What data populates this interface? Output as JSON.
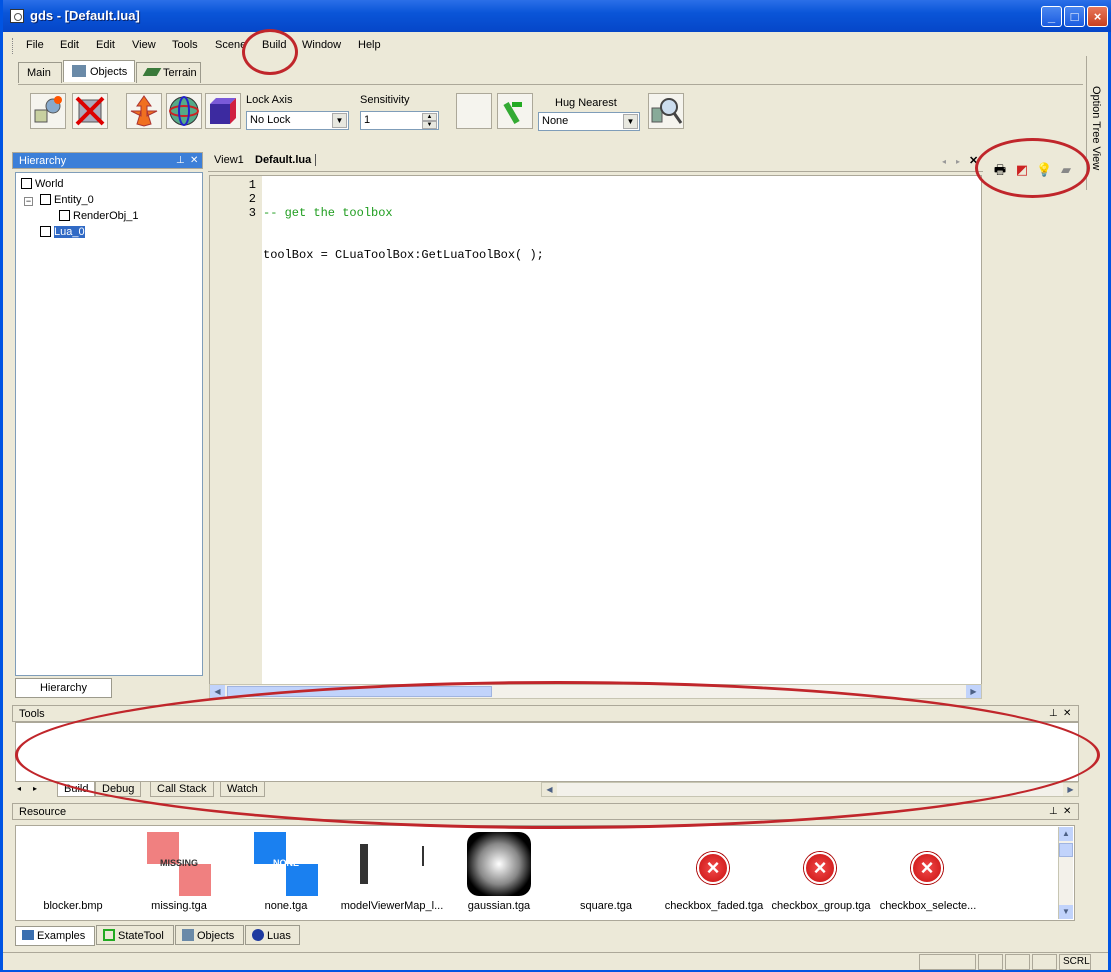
{
  "window": {
    "title": "gds - [Default.lua]"
  },
  "menubar": {
    "items": [
      "File",
      "Edit",
      "Edit",
      "View",
      "Tools",
      "Scene",
      "Build",
      "Window",
      "Help"
    ]
  },
  "top_tabs": [
    {
      "label": "Main"
    },
    {
      "label": "Objects",
      "icon": "objects-icon"
    },
    {
      "label": "Terrain",
      "icon": "terrain-icon"
    }
  ],
  "toolbar": {
    "lock_axis_label": "Lock Axis",
    "lock_axis_value": "No Lock",
    "sensitivity_label": "Sensitivity",
    "sensitivity_value": "1",
    "hug_nearest_label": "Hug Nearest",
    "hug_nearest_value": "None"
  },
  "option_tree": {
    "label": "Option Tree View"
  },
  "hierarchy": {
    "title": "Hierarchy",
    "tab_label": "Hierarchy",
    "nodes": [
      {
        "label": "World",
        "depth": 0
      },
      {
        "label": "Entity_0",
        "depth": 1
      },
      {
        "label": "RenderObj_1",
        "depth": 2
      },
      {
        "label": "Lua_0",
        "depth": 1,
        "selected": true
      }
    ]
  },
  "editor": {
    "tabs": [
      "View1",
      "Default.lua"
    ],
    "active_tab": "Default.lua",
    "lines": [
      {
        "num": "1",
        "text": "-- get the toolbox",
        "type": "comment"
      },
      {
        "num": "2",
        "text": "toolBox = CLuaToolBox:GetLuaToolBox( );",
        "type": "code"
      },
      {
        "num": "3",
        "text": "",
        "type": "code"
      }
    ]
  },
  "tools_panel": {
    "title": "Tools",
    "tabs": [
      "Build",
      "Debug",
      "Call Stack",
      "Watch"
    ]
  },
  "resource_panel": {
    "title": "Resource",
    "items": [
      {
        "name": "blocker.bmp",
        "thumb": "blank"
      },
      {
        "name": "missing.tga",
        "thumb": "missing",
        "thumb_text": "MISSING"
      },
      {
        "name": "none.tga",
        "thumb": "none",
        "thumb_text": "NONE"
      },
      {
        "name": "modelViewerMap_l...",
        "thumb": "map"
      },
      {
        "name": "gaussian.tga",
        "thumb": "gaussian"
      },
      {
        "name": "square.tga",
        "thumb": "blank"
      },
      {
        "name": "checkbox_faded.tga",
        "thumb": "x"
      },
      {
        "name": "checkbox_group.tga",
        "thumb": "x"
      },
      {
        "name": "checkbox_selecte...",
        "thumb": "x"
      }
    ],
    "tabs": [
      {
        "label": "Examples",
        "icon": "examples-icon"
      },
      {
        "label": "StateTool",
        "icon": "statetool-icon"
      },
      {
        "label": "Objects",
        "icon": "objects-icon"
      },
      {
        "label": "Luas",
        "icon": "luas-icon"
      }
    ]
  },
  "statusbar": {
    "scrl": "SCRL"
  },
  "colors": {
    "accent": "#316ac5",
    "annotation": "#c0262b",
    "comment": "#1f9d1f"
  }
}
